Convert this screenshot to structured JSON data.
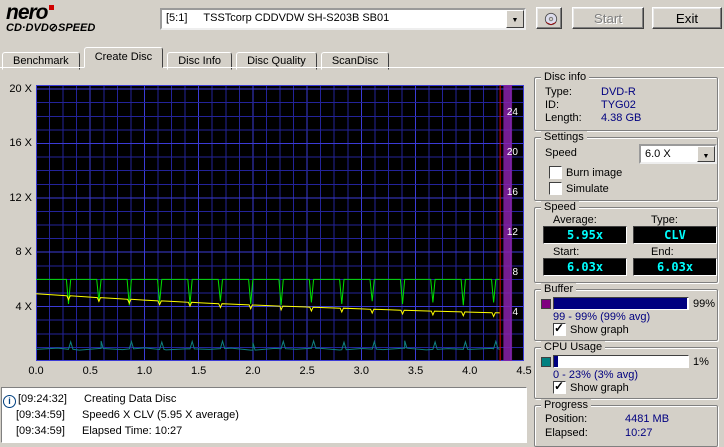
{
  "header": {
    "logo_top": "nero",
    "logo_sub_left": "CD·DVD",
    "logo_sub_right": "SPEED",
    "drive": {
      "prefix": "[5:1]",
      "name": "TSSTcorp CDDVDW SH-S203B SB01"
    },
    "start_label": "Start",
    "exit_label": "Exit"
  },
  "tabs": [
    {
      "label": "Benchmark"
    },
    {
      "label": "Create Disc"
    },
    {
      "label": "Disc Info"
    },
    {
      "label": "Disc Quality"
    },
    {
      "label": "ScanDisc"
    }
  ],
  "chart_data": {
    "type": "line",
    "title": "Create Disc write graph",
    "x_unit": "GB",
    "x_ticks": [
      "0.0",
      "0.5",
      "1.0",
      "1.5",
      "2.0",
      "2.5",
      "3.0",
      "3.5",
      "4.0",
      "4.5"
    ],
    "x_tick_values": [
      0,
      0.5,
      1,
      1.5,
      2,
      2.5,
      3,
      3.5,
      4,
      4.5
    ],
    "y_ticks_left": [
      "20 X",
      "16 X",
      "12 X",
      "8 X",
      "4 X"
    ],
    "y_tick_values_left": [
      20,
      16,
      12,
      8,
      4
    ],
    "y_ticks_right": [
      "24",
      "20",
      "16",
      "12",
      "8",
      "4"
    ],
    "xlim": [
      0,
      4.5
    ],
    "ylim": [
      0,
      20.3
    ],
    "grid": {
      "x_minor": 0.125,
      "x_major": 0.5,
      "y_minor": 1,
      "y_major": 4
    },
    "position_marker_gb": 4.28,
    "end_band_gb": [
      4.31,
      4.39
    ],
    "colors": {
      "grid_minor": "#23239a",
      "grid_major": "#3b3bd6",
      "marker": "#e00000",
      "band": "#8822aa",
      "bg": "#000000"
    },
    "series": [
      {
        "name": "write-speed",
        "color": "#00e000",
        "points": [
          [
            0,
            6.0
          ],
          [
            4.28,
            6.0
          ]
        ],
        "dips": {
          "xs": [
            0.3,
            0.58,
            0.86,
            1.14,
            1.42,
            1.7,
            1.98,
            2.26,
            2.54,
            2.82,
            3.1,
            3.38,
            3.66,
            3.94,
            4.22
          ],
          "to": [
            4.2,
            4.4,
            4.1,
            4.3,
            4.2,
            4.4,
            4.2,
            4.1,
            4.3,
            4.2,
            4.4,
            4.2,
            4.3,
            4.1,
            4.3
          ],
          "halfwidth": 0.02
        }
      },
      {
        "name": "rotation-speed",
        "color": "#ffff00",
        "points": [
          [
            0,
            4.95
          ],
          [
            0.25,
            4.82
          ],
          [
            0.5,
            4.7
          ],
          [
            0.75,
            4.59
          ],
          [
            1.0,
            4.48
          ],
          [
            1.25,
            4.38
          ],
          [
            1.5,
            4.29
          ],
          [
            1.75,
            4.2
          ],
          [
            2.0,
            4.12
          ],
          [
            2.25,
            4.04
          ],
          [
            2.5,
            3.97
          ],
          [
            2.75,
            3.9
          ],
          [
            3.0,
            3.83
          ],
          [
            3.25,
            3.77
          ],
          [
            3.5,
            3.71
          ],
          [
            3.75,
            3.65
          ],
          [
            4.0,
            3.6
          ],
          [
            4.25,
            3.55
          ],
          [
            4.28,
            3.54
          ]
        ],
        "dips": {
          "xs": [
            0.3,
            0.58,
            0.86,
            1.14,
            1.42,
            1.7,
            1.98,
            2.26,
            2.54,
            2.82,
            3.1,
            3.38,
            3.66,
            3.94,
            4.22
          ],
          "depth": 0.28,
          "halfwidth": 0.015
        }
      },
      {
        "name": "cpu-usage",
        "color": "#0f8080",
        "points": [
          [
            0,
            0.85
          ],
          [
            0.2,
            0.95
          ],
          [
            0.4,
            0.8
          ],
          [
            0.6,
            0.92
          ],
          [
            0.8,
            0.84
          ],
          [
            1.0,
            0.96
          ],
          [
            1.2,
            0.82
          ],
          [
            1.4,
            0.9
          ],
          [
            1.6,
            0.85
          ],
          [
            1.8,
            0.95
          ],
          [
            2.0,
            0.8
          ],
          [
            2.2,
            0.93
          ],
          [
            2.4,
            0.86
          ],
          [
            2.6,
            0.95
          ],
          [
            2.8,
            0.81
          ],
          [
            3.0,
            0.92
          ],
          [
            3.2,
            0.84
          ],
          [
            3.4,
            0.94
          ],
          [
            3.6,
            0.82
          ],
          [
            3.8,
            0.91
          ],
          [
            4.0,
            0.85
          ],
          [
            4.2,
            0.93
          ],
          [
            4.28,
            0.86
          ]
        ],
        "dips": {
          "xs": [
            0.32,
            0.6,
            0.88,
            1.16,
            1.44,
            1.72,
            2.0,
            2.28,
            2.56,
            2.84,
            3.12,
            3.4,
            3.68,
            3.96,
            4.24
          ],
          "depth": -0.55,
          "halfwidth": 0.02
        }
      }
    ]
  },
  "disc_info": {
    "title": "Disc info",
    "type_label": "Type:",
    "type": "DVD-R",
    "id_label": "ID:",
    "id": "TYG02",
    "length_label": "Length:",
    "length": "4.38 GB"
  },
  "settings": {
    "title": "Settings",
    "speed_label": "Speed",
    "speed_value": "6.0 X",
    "burn_image_label": "Burn image",
    "burn_image_checked": false,
    "simulate_label": "Simulate",
    "simulate_checked": false
  },
  "speed": {
    "title": "Speed",
    "average_label": "Average:",
    "average": "5.95x",
    "type_label": "Type:",
    "type": "CLV",
    "start_label": "Start:",
    "start": "6.03x",
    "end_label": "End:",
    "end": "6.03x"
  },
  "buffer": {
    "title": "Buffer",
    "percent": "99%",
    "fill_pct": 99,
    "range": "99 - 99% (99% avg)",
    "show_graph_label": "Show graph",
    "show_graph_checked": true,
    "swatch_color": "#800080"
  },
  "cpu": {
    "title": "CPU Usage",
    "percent": "1%",
    "fill_pct": 3,
    "range": "0 - 23% (3% avg)",
    "show_graph_label": "Show graph",
    "show_graph_checked": true,
    "swatch_color": "#008080"
  },
  "progress": {
    "title": "Progress",
    "position_label": "Position:",
    "position": "4481 MB",
    "elapsed_label": "Elapsed:",
    "elapsed": "10:27"
  },
  "log": {
    "rows": [
      {
        "icon": "info",
        "time": "[09:24:32]",
        "message": "Creating Data Disc"
      },
      {
        "time": "[09:34:59]",
        "message": "Speed6 X CLV (5.95 X average)"
      },
      {
        "time": "[09:34:59]",
        "message": "Elapsed Time: 10:27"
      }
    ]
  }
}
